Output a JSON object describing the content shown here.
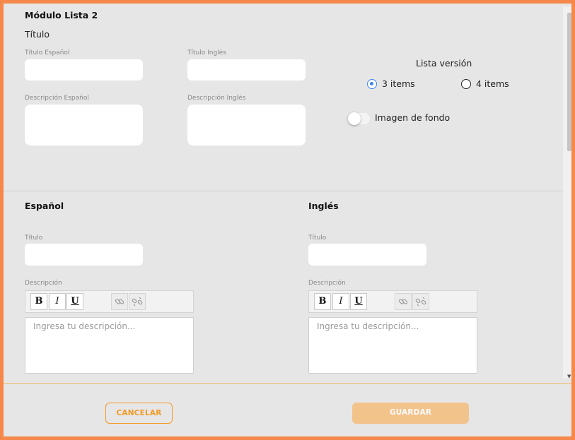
{
  "modal": {
    "title": "Módulo Lista 2",
    "section_title": "Título"
  },
  "top_fields": {
    "titulo_es_label": "Título Español",
    "titulo_en_label": "Título Inglés",
    "desc_es_label": "Descripción Español",
    "desc_en_label": "Descripción Inglés",
    "titulo_es_value": "",
    "titulo_en_value": "",
    "desc_es_value": "",
    "desc_en_value": ""
  },
  "lista": {
    "label": "Lista versión",
    "options": [
      {
        "label": "3 items",
        "selected": true
      },
      {
        "label": "4 items",
        "selected": false
      }
    ]
  },
  "imagen_fondo": {
    "label": "Imagen de fondo",
    "enabled": false
  },
  "espanol": {
    "heading": "Español",
    "titulo_label": "Título",
    "titulo_value": "",
    "descripcion_label": "Descripción",
    "editor_placeholder": "Ingresa tu descripción..."
  },
  "ingles": {
    "heading": "Inglés",
    "titulo_label": "Título",
    "titulo_value": "",
    "descripcion_label": "Descripción",
    "editor_placeholder": "Ingresa tu descripción..."
  },
  "toolbar": {
    "bold": "B",
    "italic": "I",
    "underline": "U"
  },
  "icons": {
    "link": "link-icon",
    "unlink": "unlink-icon"
  },
  "footer": {
    "cancel_label": "CANCELAR",
    "save_label": "GUARDAR"
  },
  "colors": {
    "frame_border": "#f5884a",
    "accent": "#f29a26",
    "save_disabled": "#f3c38c",
    "radio_selected": "#3b82f6"
  }
}
